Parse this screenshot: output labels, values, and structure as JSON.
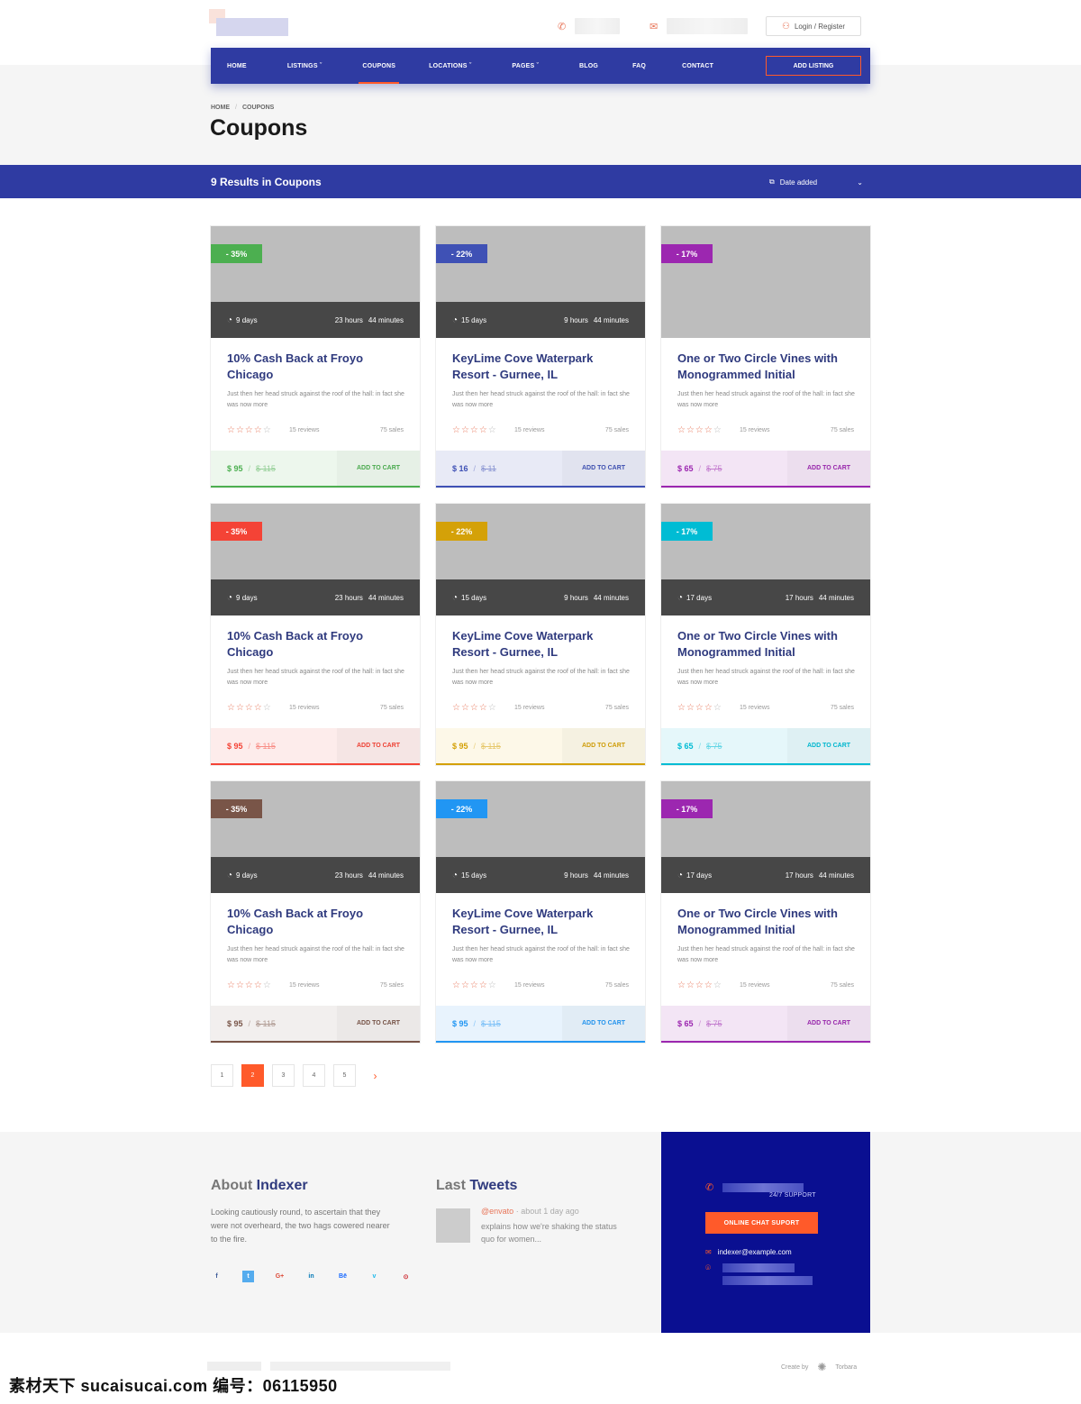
{
  "header": {
    "login_label": "Login / Register"
  },
  "nav": {
    "items": [
      {
        "label": "HOME",
        "active": false
      },
      {
        "label": "LISTINGS ˇ",
        "active": false
      },
      {
        "label": "COUPONS",
        "active": true
      },
      {
        "label": "LOCATIONS ˇ",
        "active": false
      },
      {
        "label": "PAGES ˇ",
        "active": false
      },
      {
        "label": "BLOG",
        "active": false
      },
      {
        "label": "FAQ",
        "active": false
      },
      {
        "label": "CONTACT",
        "active": false
      }
    ],
    "add_listing": "ADD LISTING"
  },
  "breadcrumb": {
    "home": "HOME",
    "sep": "/",
    "current": "COUPONS"
  },
  "page_title": "Coupons",
  "results": {
    "text": "9 Results in Coupons",
    "sort_label": "Date added"
  },
  "colors": {
    "primary": "#2f3ba2",
    "accent": "#ff5a2a",
    "footer_box": "#0a0f91"
  },
  "cards": [
    {
      "badge": "- 35%",
      "color": "#4caf50",
      "tint": "#edf7ed",
      "days": "9 days",
      "hours": "23 hours",
      "minutes": "44 minutes",
      "title": "10% Cash Back at Froyo Chicago",
      "desc": "Just then her head struck against the roof of the hall: in fact she was now more",
      "stars": 4,
      "reviews": "15 reviews",
      "sales": "75 sales",
      "price": "$ 95",
      "old": "$ 115",
      "cart": "ADD TO CART"
    },
    {
      "badge": "- 22%",
      "color": "#3f51b5",
      "tint": "#e8eaf6",
      "days": "15 days",
      "hours": "9 hours",
      "minutes": "44 minutes",
      "title": "KeyLime Cove Waterpark Resort - Gurnee, IL",
      "desc": "Just then her head struck against the roof of the hall: in fact she was now more",
      "stars": 4,
      "reviews": "15 reviews",
      "sales": "75 sales",
      "price": "$ 16",
      "old": "$ 11",
      "cart": "ADD TO CART"
    },
    {
      "badge": "- 17%",
      "color": "#9c27b0",
      "tint": "#f3e5f5",
      "days": "",
      "hours": "",
      "minutes": "",
      "title": "One or Two Circle Vines with Monogrammed Initial",
      "desc": "Just then her head struck against the roof of the hall: in fact she was now more",
      "stars": 4,
      "reviews": "15 reviews",
      "sales": "75 sales",
      "price": "$ 65",
      "old": "$ 75",
      "cart": "ADD TO CART"
    },
    {
      "badge": "- 35%",
      "color": "#f44336",
      "tint": "#fdeceb",
      "days": "9 days",
      "hours": "23 hours",
      "minutes": "44 minutes",
      "title": "10% Cash Back at Froyo Chicago",
      "desc": "Just then her head struck against the roof of the hall: in fact she was now more",
      "stars": 4,
      "reviews": "15 reviews",
      "sales": "75 sales",
      "price": "$ 95",
      "old": "$ 115",
      "cart": "ADD TO CART"
    },
    {
      "badge": "- 22%",
      "color": "#d4a108",
      "tint": "#fdf8e8",
      "days": "15 days",
      "hours": "9 hours",
      "minutes": "44 minutes",
      "title": "KeyLime Cove Waterpark Resort - Gurnee, IL",
      "desc": "Just then her head struck against the roof of the hall: in fact she was now more",
      "stars": 4,
      "reviews": "15 reviews",
      "sales": "75 sales",
      "price": "$ 95",
      "old": "$ 115",
      "cart": "ADD TO CART"
    },
    {
      "badge": "- 17%",
      "color": "#00bcd4",
      "tint": "#e5f7fa",
      "days": "17 days",
      "hours": "17 hours",
      "minutes": "44 minutes",
      "title": "One or Two Circle Vines with Monogrammed Initial",
      "desc": "Just then her head struck against the roof of the hall: in fact she was now more",
      "stars": 4,
      "reviews": "15 reviews",
      "sales": "75 sales",
      "price": "$ 65",
      "old": "$ 75",
      "cart": "ADD TO CART"
    },
    {
      "badge": "- 35%",
      "color": "#795548",
      "tint": "#f2efee",
      "days": "9 days",
      "hours": "23 hours",
      "minutes": "44 minutes",
      "title": "10% Cash Back at Froyo Chicago",
      "desc": "Just then her head struck against the roof of the hall: in fact she was now more",
      "stars": 4,
      "reviews": "15 reviews",
      "sales": "75 sales",
      "price": "$ 95",
      "old": "$ 115",
      "cart": "ADD TO CART"
    },
    {
      "badge": "- 22%",
      "color": "#2196f3",
      "tint": "#e8f3fd",
      "days": "15 days",
      "hours": "9 hours",
      "minutes": "44 minutes",
      "title": "KeyLime Cove Waterpark Resort - Gurnee, IL",
      "desc": "Just then her head struck against the roof of the hall: in fact she was now more",
      "stars": 4,
      "reviews": "15 reviews",
      "sales": "75 sales",
      "price": "$ 95",
      "old": "$ 115",
      "cart": "ADD TO CART"
    },
    {
      "badge": "- 17%",
      "color": "#9c27b0",
      "tint": "#f3e5f5",
      "days": "17 days",
      "hours": "17 hours",
      "minutes": "44 minutes",
      "title": "One or Two Circle Vines with Monogrammed Initial",
      "desc": "Just then her head struck against the roof of the hall: in fact she was now more",
      "stars": 4,
      "reviews": "15 reviews",
      "sales": "75 sales",
      "price": "$ 65",
      "old": "$ 75",
      "cart": "ADD TO CART"
    }
  ],
  "pagination": {
    "pages": [
      "1",
      "2",
      "3",
      "4",
      "5"
    ],
    "current": "2",
    "next": "›"
  },
  "footer": {
    "about_title_a": "About",
    "about_title_b": "Indexer",
    "about_text": "Looking cautiously round, to ascertain that they were not overheard, the two hags cowered nearer to the fire.",
    "social": [
      {
        "icon": "facebook-icon",
        "glyph": "f",
        "color": "#3b5998"
      },
      {
        "icon": "twitter-icon",
        "glyph": "t",
        "color": "#ffffff",
        "bg": "#55acee"
      },
      {
        "icon": "google-plus-icon",
        "glyph": "G+",
        "color": "#dd4b39"
      },
      {
        "icon": "linkedin-icon",
        "glyph": "in",
        "color": "#0077b5"
      },
      {
        "icon": "behance-icon",
        "glyph": "Bē",
        "color": "#1769ff"
      },
      {
        "icon": "vimeo-icon",
        "glyph": "v",
        "color": "#1ab7ea"
      },
      {
        "icon": "pinterest-icon",
        "glyph": "⊙",
        "color": "#cb2027"
      }
    ],
    "tweets_title_a": "Last",
    "tweets_title_b": "Tweets",
    "tweet_handle": "@envato",
    "tweet_sep": "·",
    "tweet_time": "about 1 day ago",
    "tweet_text": "explains how we're shaking the status quo for women...",
    "support_label": "24/7 SUPPORT",
    "chat_button": "ONLINE CHAT SUPORT",
    "email": "indexer@example.com",
    "create_by": "Create by",
    "brand": "Torbara"
  },
  "watermark": "素材天下 sucaisucai.com  编号：06115950"
}
